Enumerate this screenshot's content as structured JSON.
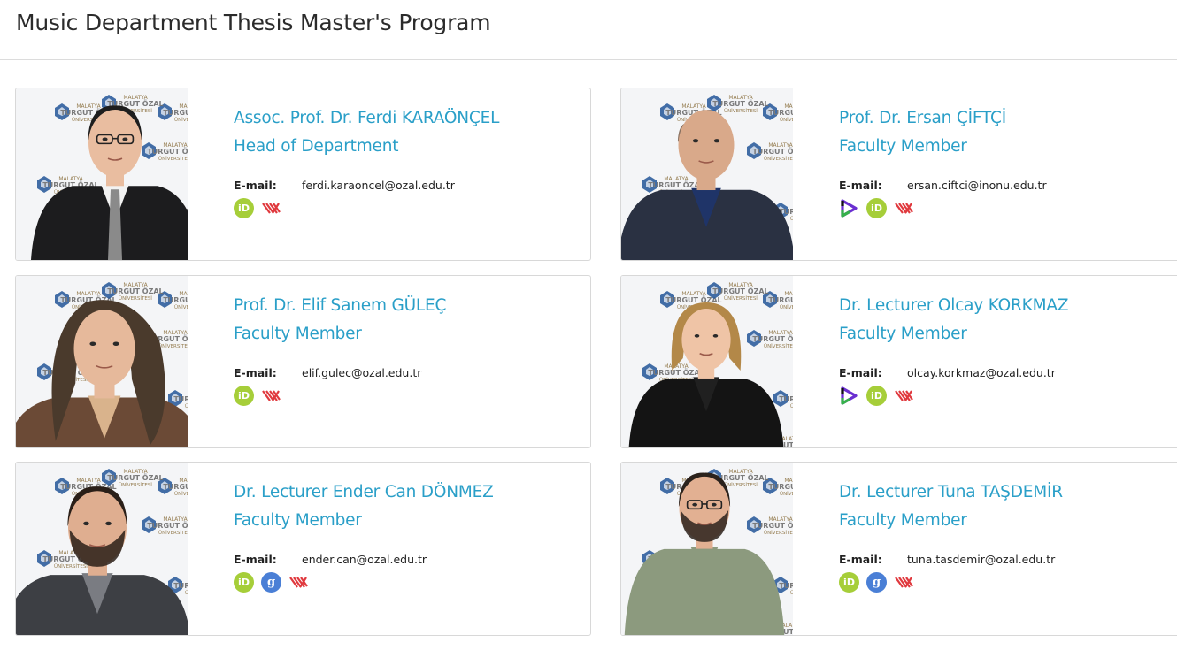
{
  "page": {
    "title": "Music Department Thesis Master's Program"
  },
  "logo_text": [
    "MALATYA",
    "TURGUT ÖZAL",
    "ÜNİVERSİTESİ"
  ],
  "colors": {
    "link": "#2a9fc8",
    "orcid": "#a6ce39",
    "scholar": "#4a7fd6",
    "yoksis": "#e0393e"
  },
  "email_label": "E-mail:",
  "members": [
    {
      "name": "Assoc. Prof. Dr. Ferdi KARAÖNÇEL",
      "role": "Head of Department",
      "email": "ferdi.karaoncel@ozal.edu.tr",
      "icons": [
        "orcid-icon",
        "yoksis-icon"
      ]
    },
    {
      "name": "Prof. Dr. Ersan ÇİFTÇİ",
      "role": "Faculty Member",
      "email": "ersan.ciftci@inonu.edu.tr",
      "icons": [
        "publons-icon",
        "orcid-icon",
        "yoksis-icon"
      ]
    },
    {
      "name": "Prof. Dr. Elif Sanem GÜLEÇ",
      "role": "Faculty Member",
      "email": "elif.gulec@ozal.edu.tr",
      "icons": [
        "orcid-icon",
        "yoksis-icon"
      ]
    },
    {
      "name": "Dr. Lecturer Olcay KORKMAZ",
      "role": "Faculty Member",
      "email": "olcay.korkmaz@ozal.edu.tr",
      "icons": [
        "publons-icon",
        "orcid-icon",
        "yoksis-icon"
      ]
    },
    {
      "name": "Dr. Lecturer Ender Can DÖNMEZ",
      "role": "Faculty Member",
      "email": "ender.can@ozal.edu.tr",
      "icons": [
        "orcid-icon",
        "google-scholar-icon",
        "yoksis-icon"
      ]
    },
    {
      "name": "Dr. Lecturer Tuna TAŞDEMİR",
      "role": "Faculty Member",
      "email": "tuna.tasdemir@ozal.edu.tr",
      "icons": [
        "orcid-icon",
        "google-scholar-icon",
        "yoksis-icon"
      ]
    }
  ]
}
